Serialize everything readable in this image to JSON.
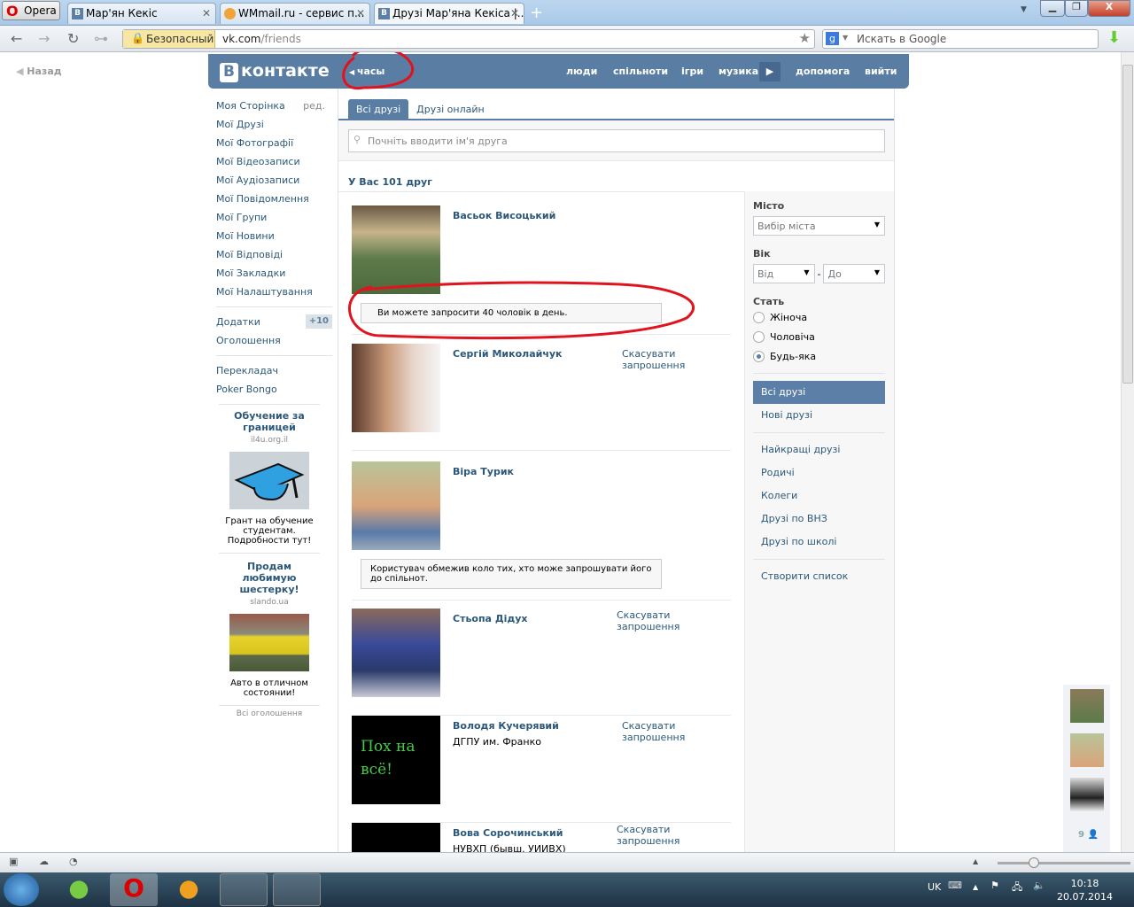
{
  "browser": {
    "menu_label": "Opera",
    "tabs": [
      {
        "favicon": "В",
        "title": "Мар'ян Кекіс"
      },
      {
        "favicon": "wmmail-icon",
        "title": "WMmail.ru - сервис п..."
      },
      {
        "favicon": "В",
        "title": "Друзі Мар'яна Кекіса |..."
      }
    ],
    "security_label": "Безопасный",
    "url_host": "vk.com",
    "url_path": "/friends",
    "search_placeholder": "Искать в Google"
  },
  "page": {
    "back_label": "Назад",
    "logo": {
      "mark": "В",
      "text": "контакте"
    },
    "header_back": "часы",
    "nav": [
      "люди",
      "спільноти",
      "ігри",
      "музика",
      "допомога",
      "вийти"
    ],
    "sidebar": {
      "items": [
        {
          "label": "Моя Сторінка",
          "extra": "ред."
        },
        {
          "label": "Мої Друзі"
        },
        {
          "label": "Мої Фотографії"
        },
        {
          "label": "Мої Відеозаписи"
        },
        {
          "label": "Мої Аудіозаписи"
        },
        {
          "label": "Мої Повідомлення"
        },
        {
          "label": "Мої Групи"
        },
        {
          "label": "Мої Новини"
        },
        {
          "label": "Мої Відповіді"
        },
        {
          "label": "Мої Закладки"
        },
        {
          "label": "Мої Налаштування"
        }
      ],
      "apps": {
        "label": "Додатки",
        "count": "+10"
      },
      "ads_label": "Оголошення",
      "extra": [
        "Перекладач",
        "Poker Bongo"
      ],
      "ads": [
        {
          "title": "Обучение за границей",
          "domain": "il4u.org.il",
          "text": "Грант на обучение студентам. Подробности тут!"
        },
        {
          "title": "Продам любимую шестерку!",
          "domain": "slando.ua",
          "text": "Авто в отличном состоянии!"
        }
      ],
      "all_ads": "Всі оголошення"
    },
    "tabs": [
      "Всі друзі",
      "Друзі онлайн"
    ],
    "search_placeholder": "Почніть вводити ім'я друга",
    "count": "У Вас 101 друг",
    "friends": [
      {
        "name": "Васьок Висоцький",
        "notice": "Ви можете запросити 40 чоловік в день."
      },
      {
        "name": "Сергій Миколайчук",
        "action": "Скасувати запрошення"
      },
      {
        "name": "Віра Турик",
        "notice": "Користувач обмежив коло тих, хто може запрошувати його до спільнот."
      },
      {
        "name": "Стьопа Дідух",
        "action": "Скасувати запрошення"
      },
      {
        "name": "Володя Кучерявий",
        "sub": "ДГПУ им. Франко",
        "action": "Скасувати запрошення",
        "photo_text": "Пох на всё!"
      },
      {
        "name": "Вова Сорочинський",
        "sub": "НУВХП (бывш. УИИВХ)",
        "action": "Скасувати запрошення"
      }
    ],
    "filters": {
      "city_label": "Місто",
      "city_value": "Вибір міста",
      "age_label": "Вік",
      "age_from": "Від",
      "age_to": "До",
      "age_sep": "-",
      "sex_label": "Стать",
      "sex_options": [
        "Жіноча",
        "Чоловіча",
        "Будь-яка"
      ],
      "sex_selected": 2,
      "lists": [
        "Всі друзі",
        "Нові друзі"
      ],
      "lists2": [
        "Найкращі друзі",
        "Родичі",
        "Колеги",
        "Друзі по ВНЗ",
        "Друзі по школі"
      ],
      "create": "Створити список"
    },
    "online_count": "9"
  },
  "taskbar": {
    "lang": "UK",
    "time": "10:18",
    "date": "20.07.2014"
  },
  "colors": {
    "vk_blue": "#597da3",
    "link": "#2b587a",
    "annotation": "#e0141e"
  }
}
